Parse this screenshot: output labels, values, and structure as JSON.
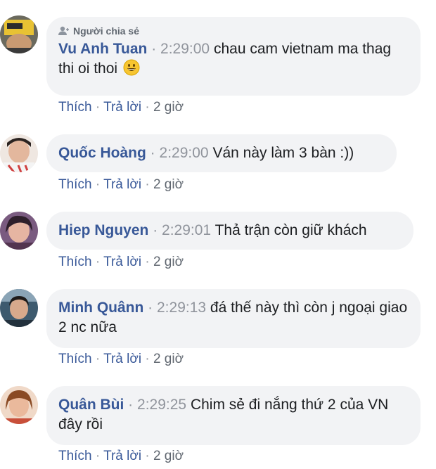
{
  "shared_label": "Người chia sẻ",
  "actions": {
    "like": "Thích",
    "reply": "Trả lời",
    "sep": "·"
  },
  "comments": [
    {
      "name": "Vu Anh Tuan",
      "time": "2:29:00",
      "text": "chau cam vietnam ma thag thi oi thoi",
      "ago": "2 giờ",
      "emoji": "grinning-face-emoji"
    },
    {
      "name": "Quốc Hoàng",
      "time": "2:29:00",
      "text": "Ván này làm 3 bàn :))",
      "ago": "2 giờ"
    },
    {
      "name": "Hiep Nguyen",
      "time": "2:29:01",
      "text": "Thả trận còn giữ khách",
      "ago": "2 giờ"
    },
    {
      "name": "Minh Quânn",
      "time": "2:29:13",
      "text": "đá thế này thì còn j ngoại giao 2 nc nữa",
      "ago": "2 giờ"
    },
    {
      "name": "Quân Bùi",
      "time": "2:29:25",
      "text": "Chim sẻ đi nắng thứ 2 của VN đây rồi",
      "ago": "2 giờ"
    }
  ],
  "colors": {
    "name": "#385898",
    "bubble": "#f2f3f5",
    "time": "#90949c"
  }
}
